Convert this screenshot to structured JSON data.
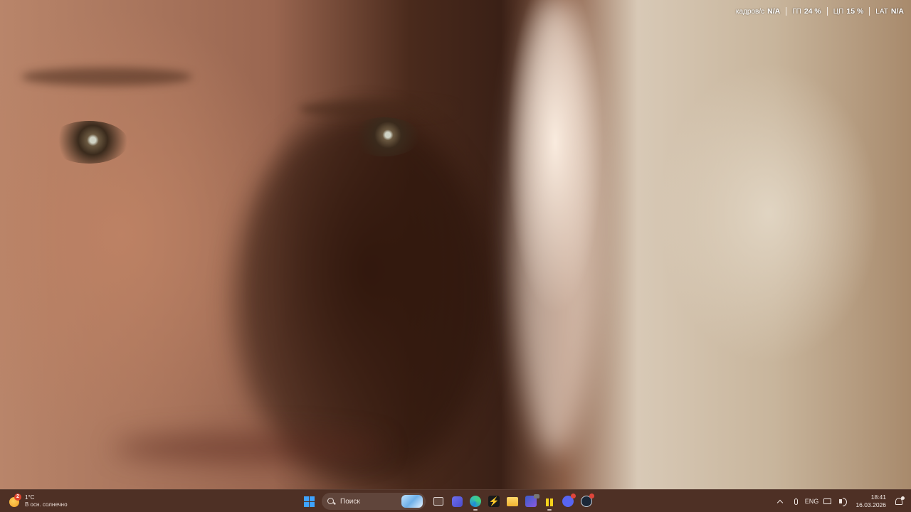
{
  "overlay": {
    "fps_label": "кадров/с",
    "fps_value": "N/A",
    "gpu_label": "ГП",
    "gpu_value": "24 %",
    "cpu_label": "ЦП",
    "cpu_value": "15 %",
    "lat_label": "LAT",
    "lat_value": "N/A"
  },
  "weather": {
    "badge": "2",
    "temperature": "1°C",
    "condition": "В осн. солнечно"
  },
  "taskbar": {
    "search_placeholder": "Поиск",
    "apps": [
      "start-icon",
      "task-view-icon",
      "meet-icon",
      "edge-icon",
      "bolt-app-icon",
      "file-explorer-icon",
      "app-icon",
      "yellow-app-icon",
      "discord-icon",
      "steam-icon"
    ],
    "accent_color": "#3ea3ff"
  },
  "tray": {
    "language": "ENG",
    "time": "18:41",
    "date": "16.03.2026"
  }
}
